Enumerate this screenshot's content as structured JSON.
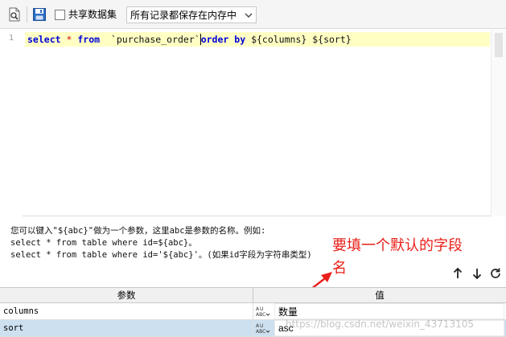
{
  "toolbar": {
    "share_label": "共享数据集",
    "share_checked": false,
    "storage_select": {
      "value": "所有记录都保存在内存中"
    },
    "icons": [
      "preview-icon",
      "save-icon",
      "chevron-down-icon"
    ]
  },
  "editor": {
    "line_number": "1",
    "code_tokens": {
      "kw_select": "select",
      "star": "*",
      "kw_from": "from",
      "table": "`purchase_order`",
      "kw_order": "order",
      "kw_by": "by",
      "tail": "${columns} ${sort}"
    }
  },
  "help": {
    "line1": "您可以键入\"${abc}\"做为一个参数，这里abc是参数的名称。例如:",
    "line2": "select * from table where id=${abc}。",
    "line3": "select * from table where id='${abc}'。(如果id字段为字符串类型)"
  },
  "annotation": {
    "line1": "要填一个默认的字段",
    "line2": "名",
    "color": "#e8201a"
  },
  "params": {
    "headers": {
      "name": "参数",
      "value": "值"
    },
    "rows": [
      {
        "name": "columns",
        "value": "数量"
      },
      {
        "name": "sort",
        "value": "asc"
      }
    ],
    "icons": [
      "arrow-up-icon",
      "arrow-down-icon",
      "refresh-icon",
      "abc-type-icon"
    ]
  },
  "watermark": "https://blog.csdn.net/weixin_43713105"
}
